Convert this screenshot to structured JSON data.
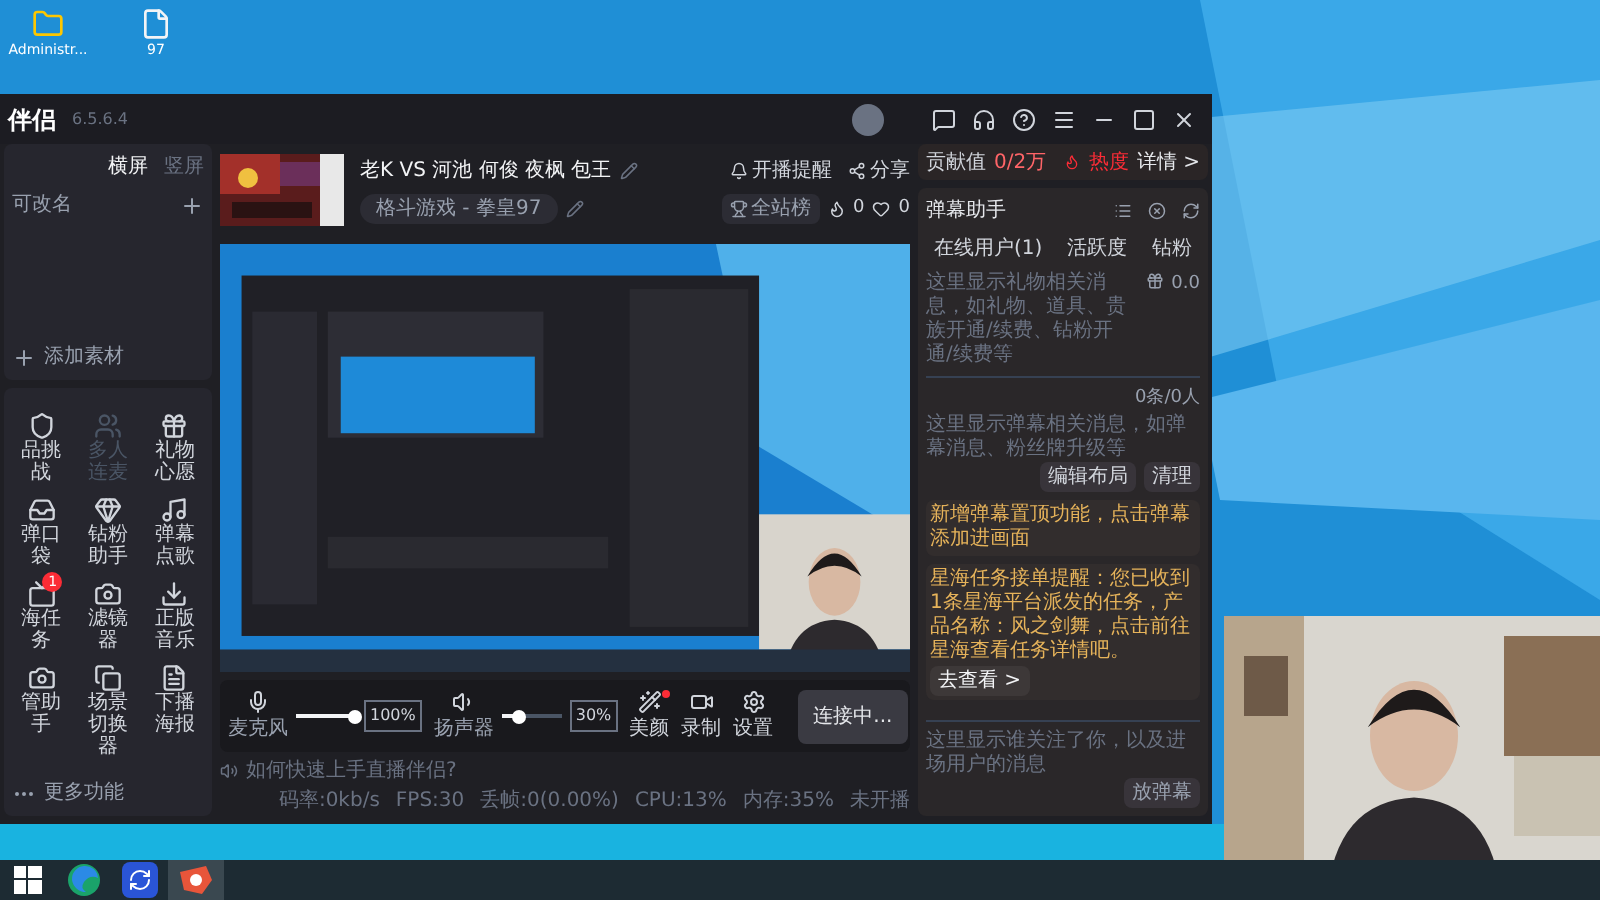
{
  "desktop": {
    "icons": [
      {
        "kind": "user",
        "label": "Administr..."
      },
      {
        "kind": "file",
        "label": "97"
      }
    ]
  },
  "app": {
    "logo": "伴侣",
    "version": "6.5.6.4"
  },
  "scenes": {
    "tabs": [
      {
        "label": "横屏",
        "selected": true
      },
      {
        "label": "竖屏",
        "selected": false
      }
    ],
    "items": [
      {
        "label": "可改名"
      }
    ],
    "add": "添加素材"
  },
  "tools": [
    {
      "label": "品挑战",
      "disabled": false
    },
    {
      "label": "多人连麦",
      "disabled": true
    },
    {
      "label": "礼物心愿",
      "disabled": false
    },
    {
      "label": "弹口袋",
      "disabled": false
    },
    {
      "label": "钻粉助手",
      "disabled": false
    },
    {
      "label": "弹幕点歌",
      "disabled": false
    },
    {
      "label": "海任务",
      "disabled": false,
      "badge": "1"
    },
    {
      "label": "滤镜器",
      "disabled": false
    },
    {
      "label": "正版音乐",
      "disabled": false
    },
    {
      "label": "管助手",
      "disabled": false
    },
    {
      "label": "场景切换器",
      "disabled": false
    },
    {
      "label": "下播海报",
      "disabled": false
    }
  ],
  "more": "更多功能",
  "stream": {
    "title": "老K VS 河池 何俊 夜枫 包王",
    "category": "格斗游戏 - 拳皇97",
    "remind": "开播提醒",
    "share": "分享",
    "rank": "全站榜",
    "likes": "0",
    "hearts": "0"
  },
  "controls": {
    "sliders": [
      {
        "label": "麦克风",
        "level": 1,
        "reading": "100%"
      },
      {
        "label": "扬声器",
        "level": 0.3,
        "reading": "30%"
      }
    ],
    "buttons": [
      {
        "label": "美颜",
        "dot": true
      },
      {
        "label": "录制",
        "dot": false
      },
      {
        "label": "设置",
        "dot": false
      }
    ],
    "connect": "连接中..."
  },
  "status": {
    "help": "如何快速上手直播伴侣?",
    "stats": [
      "码率:0kb/s",
      "FPS:30",
      "丢帧:0(0.00%)",
      "CPU:13%",
      "内存:35%",
      "未开播"
    ]
  },
  "panel": {
    "contribution": "贡献值",
    "goal": "0/2万",
    "heat": "热度",
    "details": "详情 >",
    "title": "弹幕助手",
    "tabs": [
      {
        "label": "在线用户(1)",
        "selected": false
      },
      {
        "label": "活跃度",
        "selected": false
      },
      {
        "label": "钻粉",
        "selected": false
      }
    ],
    "gift_hint": "这里显示礼物相关消息，如礼物、道具、贵族开通/续费、钻粉开通/续费等",
    "gift_value": "0.0",
    "danmaku_hint": "这里显示弹幕相关消息，如弹幕消息、粉丝牌升级等",
    "danmaku_count": "0条/0人",
    "edit_layout": "编辑布局",
    "clear": "清理",
    "notices": [
      {
        "text": "新增弹幕置顶功能，点击弹幕添加进画面"
      },
      {
        "text": "星海任务接单提醒：您已收到1条星海平台派发的任务，产品名称：风之剑舞，点击前往星海查看任务详情吧。",
        "action": "去查看 >"
      }
    ],
    "follow_hint": "这里显示谁关注了你，以及进场用户的消息",
    "send": "放弹幕"
  },
  "taskbar": {
    "apps": [
      {
        "kind": "start",
        "selected": false
      },
      {
        "kind": "edge",
        "selected": false
      },
      {
        "kind": "sync",
        "selected": false
      },
      {
        "kind": "live",
        "selected": true
      }
    ]
  }
}
